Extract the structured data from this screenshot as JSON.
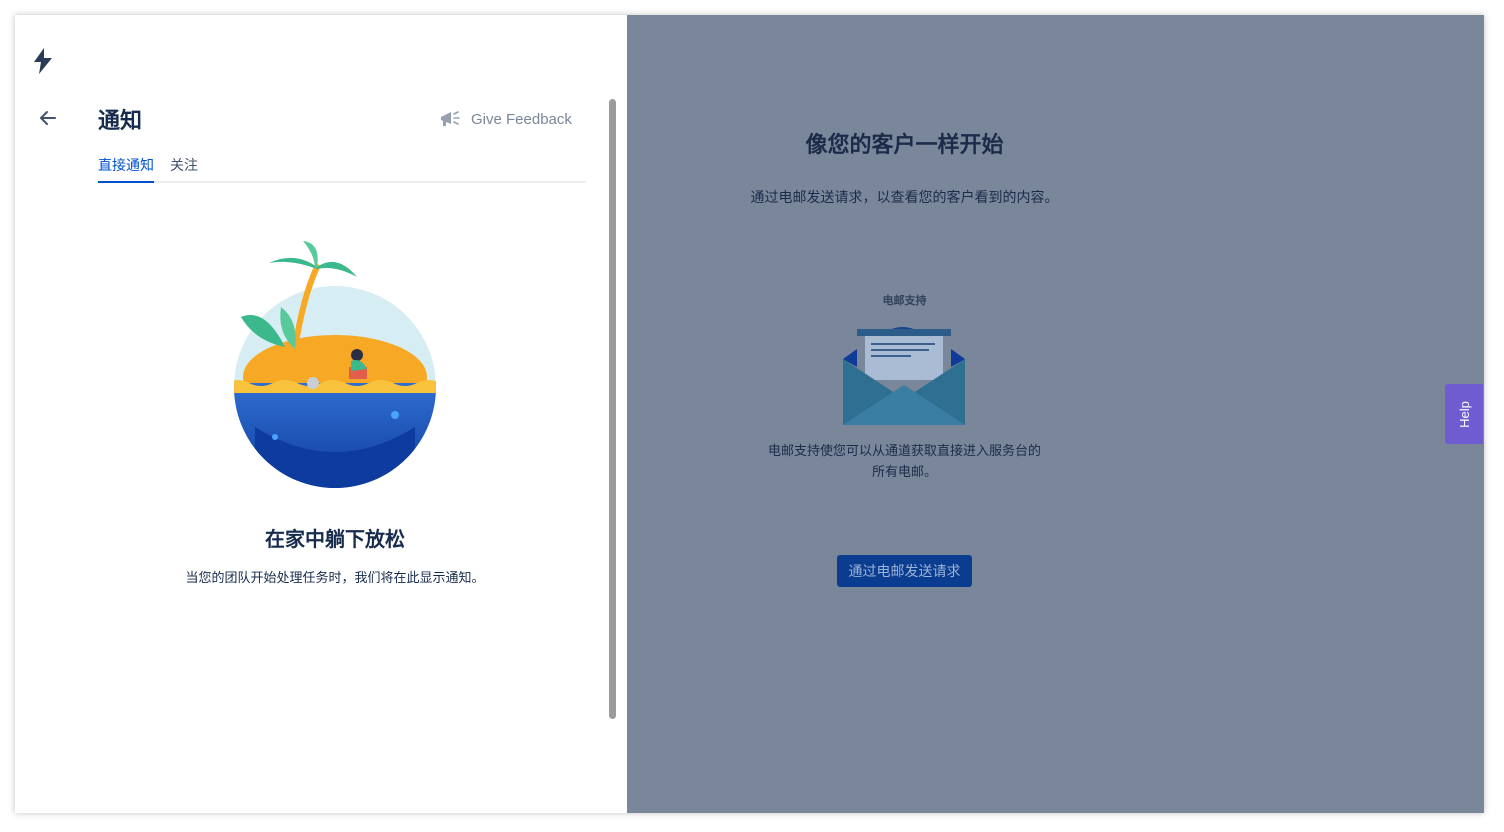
{
  "notifications_panel": {
    "title": "通知",
    "feedback_label": "Give Feedback",
    "tabs": [
      {
        "label": "直接通知",
        "active": true
      },
      {
        "label": "关注",
        "active": false
      }
    ],
    "empty_state": {
      "title": "在家中躺下放松",
      "description": "当您的团队开始处理任务时，我们将在此显示通知。"
    }
  },
  "background_page": {
    "title": "像您的客户一样开始",
    "subtitle": "通过电邮发送请求，以查看您的客户看到的内容。",
    "email_card_label": "电邮支持",
    "email_card_description": "电邮支持使您可以从通道获取直接进入服务台的所有电邮。",
    "send_button_label": "通过电邮发送请求"
  },
  "help_tab_label": "Help",
  "colors": {
    "primary": "#0052cc",
    "overlay": "#7a8699",
    "help": "#6f5cd1",
    "text_dark": "#172b4d"
  },
  "icons": [
    "logo-icon",
    "back-arrow-icon",
    "megaphone-icon",
    "island-illustration",
    "envelope-illustration"
  ]
}
